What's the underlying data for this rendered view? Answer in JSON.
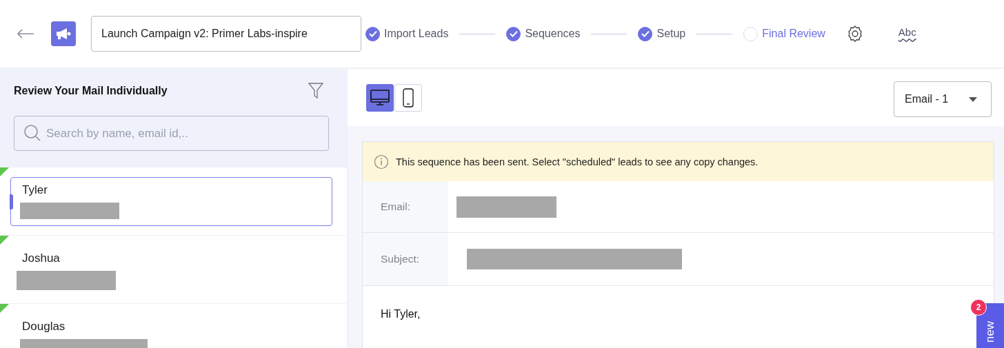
{
  "header": {
    "campaign_title": "Launch Campaign v2: Primer Labs-inspire",
    "steps": [
      {
        "label": "Import Leads",
        "completed": true,
        "selected": false
      },
      {
        "label": "Sequences",
        "completed": true,
        "selected": false
      },
      {
        "label": "Setup",
        "completed": true,
        "selected": false
      },
      {
        "label": "Final Review",
        "completed": false,
        "selected": true
      }
    ],
    "spellcheck_label": "Abc"
  },
  "sidebar": {
    "title": "Review Your Mail Individually",
    "search": {
      "placeholder": "Search by name, email id,.."
    },
    "leads": [
      {
        "name": "Tyler",
        "selected": true,
        "marked": true,
        "email_redacted": true
      },
      {
        "name": "Joshua",
        "selected": false,
        "marked": true,
        "email_redacted": true
      },
      {
        "name": "Douglas",
        "selected": false,
        "marked": true,
        "email_redacted": true
      }
    ]
  },
  "preview": {
    "devices": [
      {
        "kind": "desktop",
        "selected": true
      },
      {
        "kind": "mobile",
        "selected": false
      }
    ],
    "email_select": "Email - 1",
    "notice": "This sequence has been sent. Select \"scheduled\" leads to see any copy changes.",
    "fields": [
      {
        "label": "Email:",
        "redacted": true
      },
      {
        "label": "Subject:",
        "redacted": true
      }
    ],
    "body": "Hi Tyler,"
  },
  "new_tab": {
    "label": "new",
    "badge": "2"
  }
}
